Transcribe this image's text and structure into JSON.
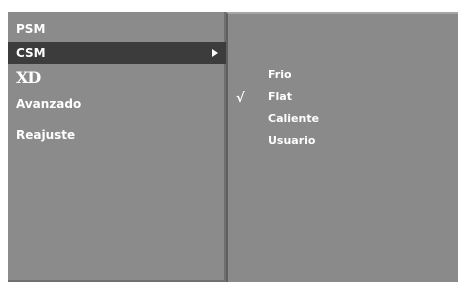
{
  "menu": {
    "items": [
      {
        "label": "PSM",
        "selected": false
      },
      {
        "label": "CSM",
        "selected": true
      },
      {
        "label": "XD",
        "selected": false
      },
      {
        "label": "Avanzado",
        "selected": false
      },
      {
        "label": "Reajuste",
        "selected": false
      }
    ]
  },
  "submenu": {
    "items": [
      {
        "label": "Frio",
        "checked": false
      },
      {
        "label": "Flat",
        "checked": true
      },
      {
        "label": "Caliente",
        "checked": false
      },
      {
        "label": "Usuario",
        "checked": false
      }
    ],
    "check_mark": "√"
  },
  "icons": {
    "submenu_arrow": "triangle-right-icon",
    "checked": "check-icon"
  },
  "colors": {
    "panel_bg": "#8b8b8b",
    "selected_bg": "#3c3c3c",
    "text": "#ffffff"
  }
}
